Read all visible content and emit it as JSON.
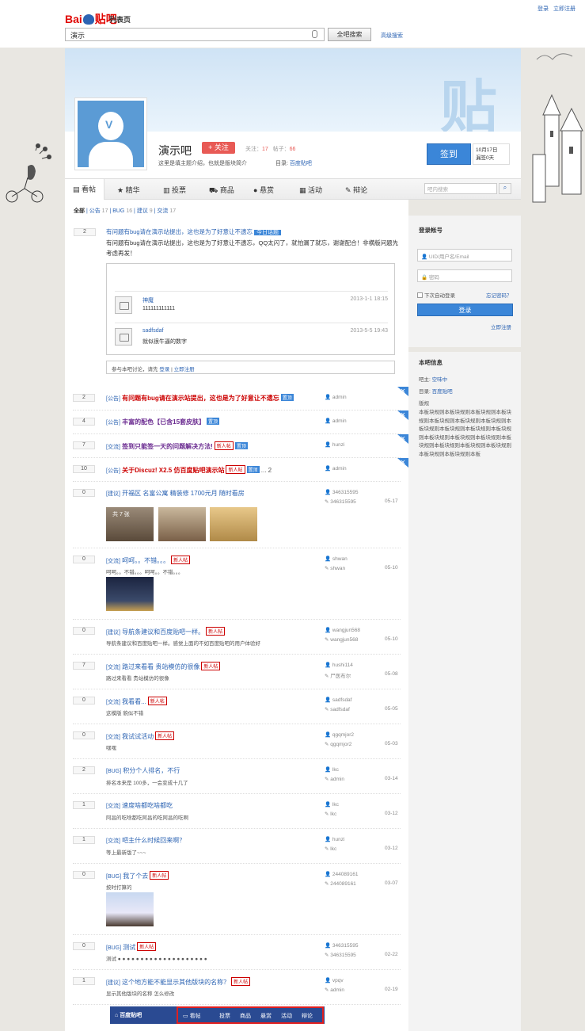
{
  "header": {
    "logo_part1": "Bai",
    "logo_part2": "贴吧",
    "page_label": "列表页",
    "search_value": "演示",
    "search_button": "全吧搜索",
    "advanced_search": "高级搜索",
    "login": "登录",
    "register": "立即注册"
  },
  "banner": {
    "watermark": "贴"
  },
  "forum": {
    "name": "演示吧",
    "follow_label": "+ 关注",
    "followers_label": "关注：",
    "followers": "17",
    "posts_label": "帖子：",
    "posts": "66",
    "intro": "这里是填主题介绍，也就是版块简介",
    "dir_label": "目录:",
    "dir_value": "百度贴吧",
    "sign_button": "签到",
    "sign_date": "10月17日",
    "sign_count": "漏签0天"
  },
  "tabs": [
    {
      "label": "看帖",
      "icon": "list-icon"
    },
    {
      "label": "精华",
      "icon": "star-icon"
    },
    {
      "label": "投票",
      "icon": "chart-icon"
    },
    {
      "label": "商品",
      "icon": "cart-icon"
    },
    {
      "label": "悬赏",
      "icon": "reward-icon"
    },
    {
      "label": "活动",
      "icon": "calendar-icon"
    },
    {
      "label": "辩论",
      "icon": "debate-icon"
    }
  ],
  "tab_search_placeholder": "吧内搜索",
  "filters": {
    "all": "全部",
    "items": [
      {
        "label": "公告",
        "count": "17"
      },
      {
        "label": "BUG",
        "count": "16"
      },
      {
        "label": "建议",
        "count": "9"
      },
      {
        "label": "交流",
        "count": "17"
      }
    ]
  },
  "notice": {
    "count": "2",
    "title": "有问题有bug请在演示站提出，这也是为了好意让不遗忘",
    "tag": "今日话题",
    "body": "有问题有bug请在演示站提出，这也是为了好意让不遗忘，QQ太闪了，就怕漏了就忘，谢谢配合！非横版问题先考虑再发！",
    "replies": [
      {
        "name": "神魔",
        "text": "111111111111",
        "date": "2013-1-1 18:15"
      },
      {
        "name": "sadfsdaf",
        "text": "就似很牛逼的数字",
        "date": "2013-5-5 19:43"
      }
    ],
    "join_prefix": "参与本吧讨论，请先",
    "join_login": "登录",
    "join_sep": "|",
    "join_register": "立即注册"
  },
  "threads": [
    {
      "count": "2",
      "cat": "[公告]",
      "title": "有问题有bug请在演示站提出，这也是为了好意让不遗忘",
      "style": "red",
      "badges": [
        "置顶"
      ],
      "a1": "admin",
      "a2": "",
      "date": "",
      "desc": ""
    },
    {
      "count": "4",
      "cat": "[公告]",
      "title": "丰富的配色【已含15套皮肤】",
      "style": "pur",
      "badges": [
        "置顶"
      ],
      "a1": "admin",
      "a2": "",
      "date": "",
      "desc": ""
    },
    {
      "count": "7",
      "cat": "[交流]",
      "title": "签到只能签一天的问题解决方法!",
      "style": "pur",
      "badges": [
        "新人帖",
        "置顶"
      ],
      "a1": "hunzi",
      "a2": "",
      "date": "",
      "desc": ""
    },
    {
      "count": "10",
      "cat": "[公告]",
      "title": "关于Discuz! X2.5 仿百度贴吧演示站",
      "style": "red",
      "badges": [
        "新人帖",
        "置顶"
      ],
      "a1": "admin",
      "a2": "",
      "date": "",
      "desc": "",
      "pages": "... 2"
    },
    {
      "count": "0",
      "cat": "[建议]",
      "title": "开福区 名富公寓 精装修 1700元月 随时看房",
      "style": "",
      "badges": [],
      "a1": "346315595",
      "a2": "346315595",
      "date": "05-17",
      "desc": "",
      "img_count": "共 7 张"
    },
    {
      "count": "0",
      "cat": "[交流]",
      "title": "呵呵。。不错。。。",
      "style": "",
      "badges": [
        "新人帖"
      ],
      "a1": "shwan",
      "a2": "shwan",
      "date": "05-10",
      "desc": "呵呵。。不错。。。呵呵。。不错。。。"
    },
    {
      "count": "0",
      "cat": "[建议]",
      "title": "导航条建议和百度贴吧一样。",
      "style": "",
      "badges": [
        "新人帖"
      ],
      "a1": "wangjun568",
      "a2": "wangjun568",
      "date": "05-10",
      "desc": "导航条建议和百度贴吧一样。感觉上面的不如百度贴吧的用户体验好"
    },
    {
      "count": "7",
      "cat": "[交流]",
      "title": "路过来看看 贵站模仿的很像",
      "style": "",
      "badges": [
        "新人帖"
      ],
      "a1": "hushi114",
      "a2": "尸医布尔",
      "date": "05-08",
      "desc": "路过来看看 贵站模仿的很像"
    },
    {
      "count": "0",
      "cat": "[交流]",
      "title": "我看看...",
      "style": "",
      "badges": [
        "新人帖"
      ],
      "a1": "sadfsdaf",
      "a2": "sadfsdaf",
      "date": "05-05",
      "desc": "这模版 貌似不错"
    },
    {
      "count": "0",
      "cat": "[交流]",
      "title": "我试试活动",
      "style": "",
      "badges": [
        "新人帖"
      ],
      "a1": "qgqmjor2",
      "a2": "qgqmjor2",
      "date": "05-03",
      "desc": "嘿嘿"
    },
    {
      "count": "2",
      "cat": "[BUG]",
      "title": "积分个人排名，不行",
      "style": "",
      "badges": [],
      "a1": "lkc",
      "a2": "admin",
      "date": "03-14",
      "desc": "排名本来是 100多，一会变成十几了"
    },
    {
      "count": "1",
      "cat": "[交流]",
      "title": "速度啥都吃啥都吃",
      "style": "",
      "badges": [],
      "a1": "lkc",
      "a2": "lkc",
      "date": "03-12",
      "desc": "阿昌的吃啥都吃阿昌的吃阿昌的吃啊"
    },
    {
      "count": "1",
      "cat": "[交流]",
      "title": "吧主什么时候回来啊？",
      "style": "",
      "badges": [],
      "a1": "hunzi",
      "a2": "lkc",
      "date": "03-12",
      "desc": "等上最新版了~~~"
    },
    {
      "count": "0",
      "cat": "[BUG]",
      "title": "我了个去",
      "style": "",
      "badges": [
        "新人帖"
      ],
      "a1": "244089161",
      "a2": "244089161",
      "date": "03-07",
      "desc": "按时打算的"
    },
    {
      "count": "0",
      "cat": "[BUG]",
      "title": "测试",
      "style": "",
      "badges": [
        "新人帖"
      ],
      "a1": "346315595",
      "a2": "346315595",
      "date": "02-22",
      "desc": "测试 ● ● ● ● ● ● ● ● ● ● ● ● ● ● ● ● ● ● ● ●"
    },
    {
      "count": "1",
      "cat": "[建议]",
      "title": "这个地方能不能显示其他版块的名称？",
      "style": "",
      "badges": [
        "新人帖"
      ],
      "a1": "vpqv",
      "a2": "admin",
      "date": "02-19",
      "desc": "显示其他版块的名称 怎么修改"
    }
  ],
  "login_panel": {
    "title": "登录帐号",
    "user_placeholder": "UID/用户名/Email",
    "pass_placeholder": "密码",
    "remember": "下次自动登录",
    "forgot": "忘记密码？",
    "login_button": "登录",
    "register": "立即注册"
  },
  "forum_info": {
    "title": "本吧信息",
    "owner_label": "吧主:",
    "owner": "空味中",
    "dir_label": "目录:",
    "dir": "百度贴吧",
    "rules_label": "版规",
    "rules": "本板块规则本板块规则本板块规则本板块规则本板块规则本板块规则本板块规则本板块规则本板块规则本板块规则本板块规则本板块规则本板块规则本板块规则本板块规则本板块规则本板块规则本板块规则本板块规则本板块规则本板"
  },
  "footer_nav": {
    "brand": "百度贴吧",
    "items": [
      "看帖",
      "投票",
      "商品",
      "悬赏",
      "活动",
      "辩论"
    ]
  },
  "colors": {
    "accent": "#3b86d8",
    "link": "#2d64b3",
    "follow": "#e85a55"
  }
}
